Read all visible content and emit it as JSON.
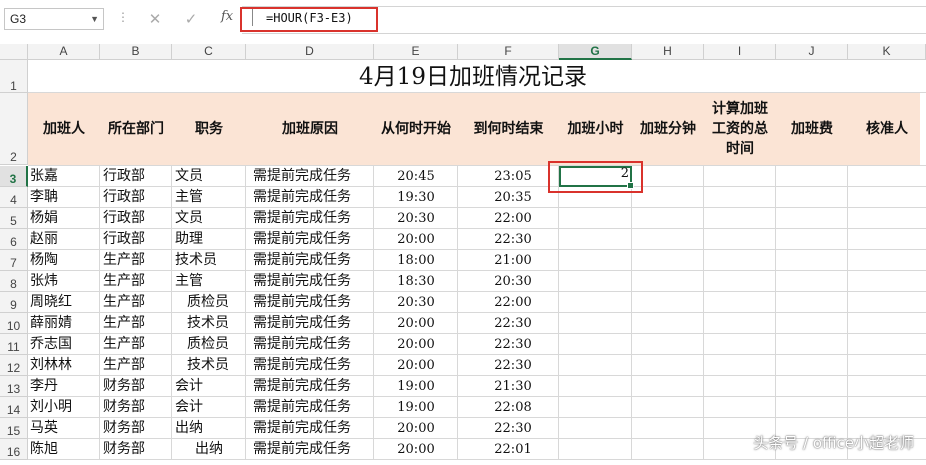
{
  "name_box": {
    "value": "G3"
  },
  "formula_bar": {
    "fx_label": "fx",
    "formula": "=HOUR(F3-E3)"
  },
  "columns": [
    "A",
    "B",
    "C",
    "D",
    "E",
    "F",
    "G",
    "H",
    "I",
    "J",
    "K"
  ],
  "selected_column": "G",
  "title": "4月19日加班情况记录",
  "headers": [
    "加班人",
    "所在部门",
    "职务",
    "加班原因",
    "从何时开始",
    "到何时结束",
    "加班小时",
    "加班分钟",
    "计算加班工资的总时间",
    "加班费",
    "核准人"
  ],
  "rows": [
    {
      "row": "3",
      "name": "张嘉",
      "dept": "行政部",
      "title": "文员",
      "reason": "需提前完成任务",
      "start": "20:45",
      "end": "23:05"
    },
    {
      "row": "4",
      "name": "李聃",
      "dept": "行政部",
      "title": "主管",
      "reason": "需提前完成任务",
      "start": "19:30",
      "end": "20:35"
    },
    {
      "row": "5",
      "name": "杨娟",
      "dept": "行政部",
      "title": "文员",
      "reason": "需提前完成任务",
      "start": "20:30",
      "end": "22:00"
    },
    {
      "row": "6",
      "name": "赵丽",
      "dept": "行政部",
      "title": "助理",
      "reason": "需提前完成任务",
      "start": "20:00",
      "end": "22:30"
    },
    {
      "row": "7",
      "name": "杨陶",
      "dept": "生产部",
      "title": "技术员",
      "reason": "需提前完成任务",
      "start": "18:00",
      "end": "21:00"
    },
    {
      "row": "8",
      "name": "张炜",
      "dept": "生产部",
      "title": "主管",
      "reason": "需提前完成任务",
      "start": "18:30",
      "end": "20:30"
    },
    {
      "row": "9",
      "name": "周晓红",
      "dept": "生产部",
      "title": "质检员",
      "reason": "需提前完成任务",
      "start": "20:30",
      "end": "22:00"
    },
    {
      "row": "10",
      "name": "薛丽婧",
      "dept": "生产部",
      "title": "技术员",
      "reason": "需提前完成任务",
      "start": "20:00",
      "end": "22:30"
    },
    {
      "row": "11",
      "name": "乔志国",
      "dept": "生产部",
      "title": "质检员",
      "reason": "需提前完成任务",
      "start": "20:00",
      "end": "22:30"
    },
    {
      "row": "12",
      "name": "刘林林",
      "dept": "生产部",
      "title": "技术员",
      "reason": "需提前完成任务",
      "start": "20:00",
      "end": "22:30"
    },
    {
      "row": "13",
      "name": "李丹",
      "dept": "财务部",
      "title": "会计",
      "reason": "需提前完成任务",
      "start": "19:00",
      "end": "21:30"
    },
    {
      "row": "14",
      "name": "刘小明",
      "dept": "财务部",
      "title": "会计",
      "reason": "需提前完成任务",
      "start": "19:00",
      "end": "22:08"
    },
    {
      "row": "15",
      "name": "马英",
      "dept": "财务部",
      "title": "出纳",
      "reason": "需提前完成任务",
      "start": "20:00",
      "end": "22:30"
    },
    {
      "row": "16",
      "name": "陈旭",
      "dept": "财务部",
      "title": "出纳",
      "reason": "需提前完成任务",
      "start": "20:00",
      "end": "22:01"
    }
  ],
  "active_cell_value": "2",
  "watermark": "头条号 / office小超老师"
}
